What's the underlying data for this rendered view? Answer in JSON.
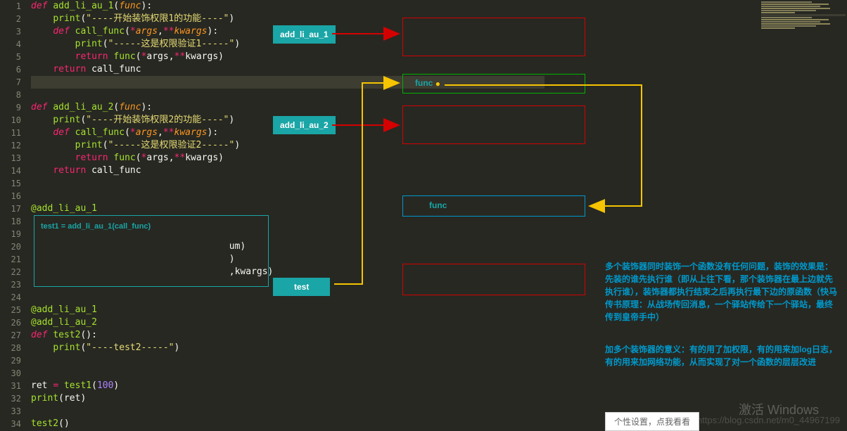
{
  "lineNumbers": [
    "1",
    "2",
    "3",
    "4",
    "5",
    "6",
    "7",
    "8",
    "9",
    "10",
    "11",
    "12",
    "13",
    "14",
    "15",
    "16",
    "17",
    "18",
    "19",
    "20",
    "21",
    "22",
    "23",
    "24",
    "25",
    "26",
    "27",
    "28",
    "29",
    "30",
    "31",
    "32",
    "33",
    "34"
  ],
  "code": {
    "l1": {
      "def": "def",
      "fn": "add_li_au_1",
      "par": "func"
    },
    "l2": {
      "print": "print",
      "str": "\"----开始装饰权限1的功能----\""
    },
    "l3": {
      "def": "def",
      "fn": "call_func",
      "ar": "args",
      "kw": "kwargs"
    },
    "l4": {
      "print": "print",
      "str": "\"-----这是权限验证1-----\""
    },
    "l5": {
      "ret": "return",
      "fn": "func",
      "ar": "args",
      "kw": "kwargs"
    },
    "l6": {
      "ret": "return",
      "id": "call_func"
    },
    "l9": {
      "def": "def",
      "fn": "add_li_au_2",
      "par": "func"
    },
    "l10": {
      "print": "print",
      "str": "\"----开始装饰权限2的功能----\""
    },
    "l11": {
      "def": "def",
      "fn": "call_func",
      "ar": "args",
      "kw": "kwargs"
    },
    "l12": {
      "print": "print",
      "str": "\"-----这是权限验证2-----\""
    },
    "l13": {
      "ret": "return",
      "fn": "func",
      "ar": "args",
      "kw": "kwargs"
    },
    "l14": {
      "ret": "return",
      "id": "call_func"
    },
    "l17": {
      "dec": "@add_li_au_1"
    },
    "l20_tail": "um)",
    "l21_tail": ")",
    "l22_tail": ",kwargs)",
    "l25": {
      "dec": "@add_li_au_1"
    },
    "l26": {
      "dec": "@add_li_au_2"
    },
    "l27": {
      "def": "def",
      "fn": "test2"
    },
    "l28": {
      "print": "print",
      "str": "\"----test2-----\""
    },
    "l31": {
      "id": "ret",
      "eq": "=",
      "fn": "test1",
      "num": "100"
    },
    "l32": {
      "print": "print",
      "id": "ret"
    },
    "l34": {
      "fn": "test2"
    }
  },
  "chips": {
    "a1": "add_li_au_1",
    "a2": "add_li_au_2",
    "test": "test"
  },
  "anno": {
    "func1": "func",
    "func2": "func",
    "test1": "test1 = add_li_au_1(call_func)"
  },
  "explain": {
    "p1": "多个装饰器同时装饰一个函数没有任何问题，装饰的效果是：先装的谁先执行谁（即从上往下看，那个装饰器在最上边就先执行谁），装饰器都执行结束之后再执行最下边的原函数（快马传书原理：从战场传回消息，一个驿站传给下一个驿站，最终传到皇帝手中）",
    "p2": "加多个装饰器的意义：有的用了加权限，有的用来加log日志，有的用来加网络功能，从而实现了对一个函数的层层改进"
  },
  "footer": {
    "pop": "个性设置，点我看看",
    "activate": "激活 Windows",
    "watermark": "https://blog.csdn.net/m0_44967199"
  }
}
